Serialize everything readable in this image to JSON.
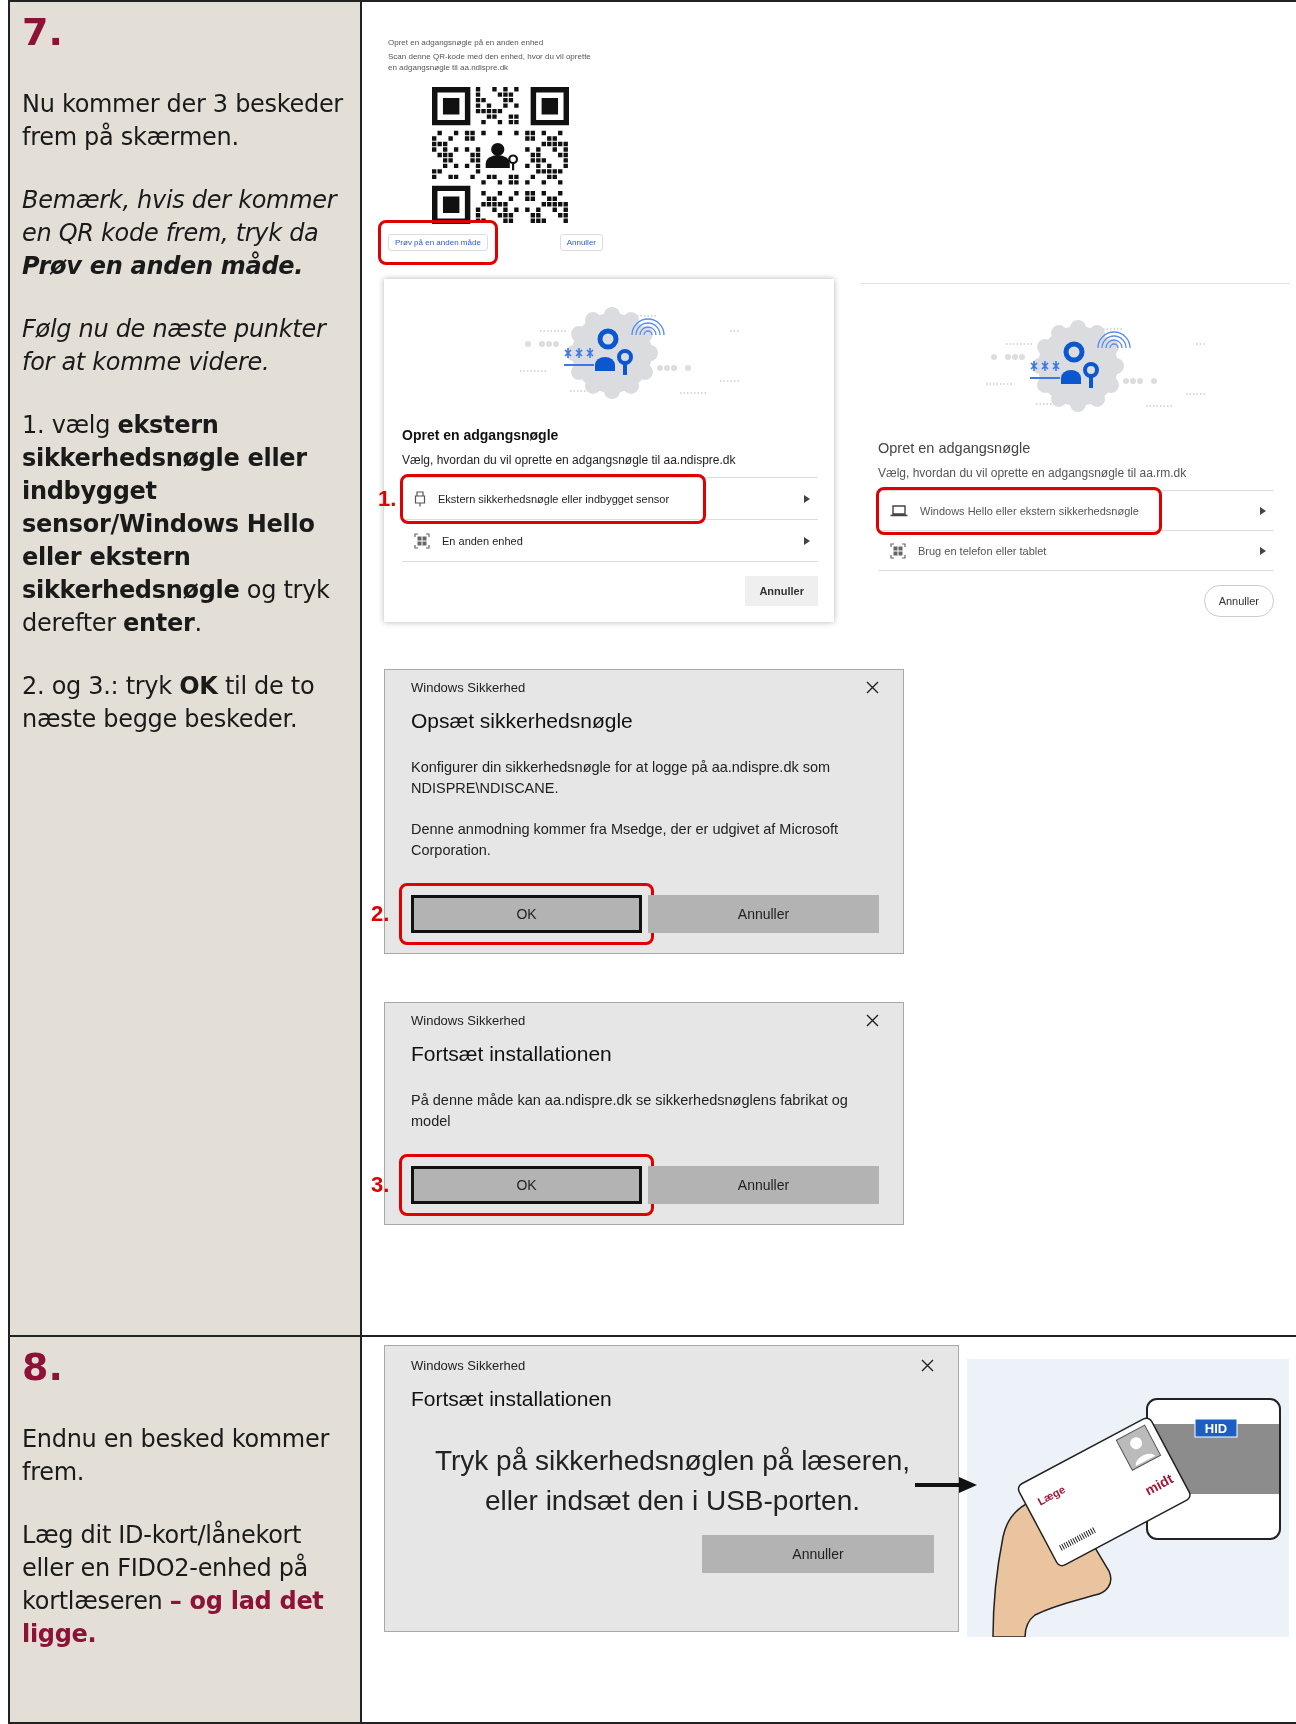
{
  "steps": [
    {
      "number": "7.",
      "paragraphs": [
        {
          "kind": "plain",
          "text": "Nu kommer der 3 beskeder frem på skærmen."
        },
        {
          "kind": "italic",
          "text": "Bemærk, hvis der kommer en QR kode frem, tryk da **Prøv en anden måde.**"
        },
        {
          "kind": "italic",
          "text": "Følg nu de næste punkter for at komme videre."
        },
        {
          "kind": "plain",
          "text": "1. vælg **ekstern sikkerhedsnøgle eller indbygget sensor/Windows Hello eller ekstern sikkerhedsnøgle** og tryk derefter **enter**."
        },
        {
          "kind": "plain",
          "text": "2. og 3.: tryk **OK** til de to næste begge beskeder."
        }
      ],
      "screen_rows": [
        {
          "items": [
            {
              "kind": "qr",
              "title": "Opret en adgangsnøgle på en anden enhed",
              "text": "Scan denne QR-kode med den enhed, hvor du vil oprette en adgangsnøgle til aa.ndispre.dk",
              "buttons": [
                {
                  "label": "Prøv på en anden måde",
                  "highlighted": true
                },
                {
                  "label": "Annuller",
                  "highlighted": false
                }
              ]
            }
          ]
        },
        {
          "items": [
            {
              "kind": "passkey",
              "marker": "1.",
              "title": "Opret en adgangsnøgle",
              "text": "Vælg, hvordan du vil oprette en adgangsnøgle til aa.ndispre.dk",
              "options": [
                {
                  "label": "Ekstern sikkerhedsnøgle eller indbygget sensor",
                  "highlighted": true
                },
                {
                  "label": "En anden enhed",
                  "highlighted": false
                }
              ],
              "cancel": "Annuller"
            },
            {
              "kind": "passkey",
              "title": "Opret en adgangsnøgle",
              "text": "Vælg, hvordan du vil oprette en adgangsnøgle til aa.rm.dk",
              "options": [
                {
                  "label": "Windows Hello eller ekstern sikkerhedsnøgle",
                  "highlighted": true
                },
                {
                  "label": "Brug en telefon eller tablet",
                  "highlighted": false
                }
              ],
              "cancel": "Annuller"
            }
          ]
        },
        {
          "items": [
            {
              "kind": "windows",
              "marker": "2.",
              "caption": "Windows Sikkerhed",
              "title": "Opsæt sikkerhedsnøgle",
              "body": [
                "Konfigurer din sikkerhedsnøgle for at logge på aa.ndispre.dk som NDISPRE\\NDISCANE.",
                "Denne anmodning kommer fra Msedge, der er udgivet af Microsoft Corporation."
              ],
              "buttons": [
                {
                  "label": "OK",
                  "focused": true,
                  "highlighted": true
                },
                {
                  "label": "Annuller",
                  "focused": false,
                  "highlighted": false
                }
              ]
            }
          ]
        },
        {
          "items": [
            {
              "kind": "windows",
              "marker": "3.",
              "caption": "Windows Sikkerhed",
              "title": "Fortsæt installationen",
              "body": [
                "På denne måde kan aa.ndispre.dk se sikkerhedsnøglens fabrikat og model"
              ],
              "buttons": [
                {
                  "label": "OK",
                  "focused": true,
                  "highlighted": true
                },
                {
                  "label": "Annuller",
                  "focused": false,
                  "highlighted": false
                }
              ]
            }
          ]
        }
      ]
    },
    {
      "number": "8.",
      "paragraphs": [
        {
          "kind": "plain",
          "text": "Endnu en besked kommer frem."
        },
        {
          "kind": "accent",
          "text": "Læg dit ID-kort/lånekort eller en FIDO2-enhed på kortlæseren **– og lad det ligge.**"
        }
      ],
      "screen_rows": [
        {
          "items": [
            {
              "kind": "windows",
              "caption": "Windows Sikkerhed",
              "title": "Fortsæt installationen",
              "message": "Tryk på sikkerhedsnøglen på læseren, eller indsæt den i USB-porten.",
              "buttons": [
                {
                  "label": "Annuller",
                  "focused": false,
                  "highlighted": false
                }
              ]
            },
            {
              "kind": "card_reader",
              "reader_logo": "HID",
              "card_label": "Læge",
              "card_brand": "midt"
            }
          ]
        }
      ]
    }
  ]
}
